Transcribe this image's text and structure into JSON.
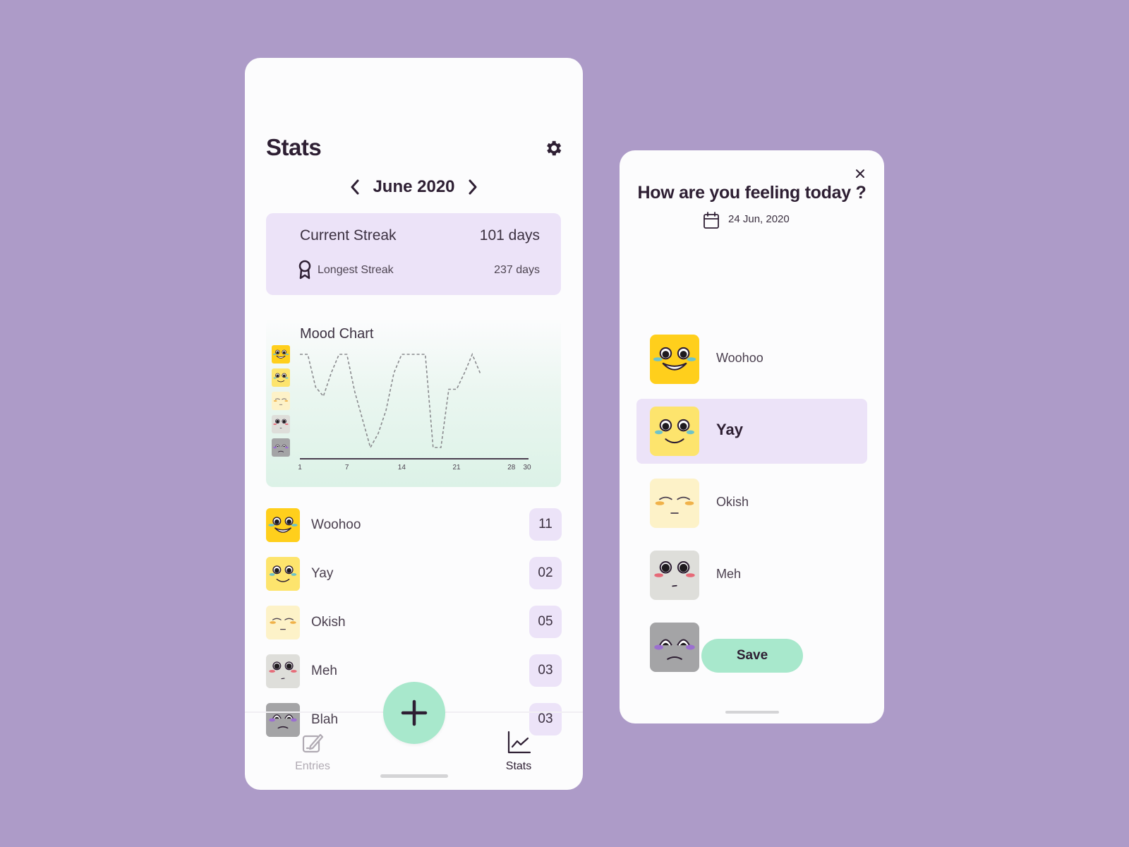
{
  "stats_screen": {
    "title": "Stats",
    "settings_icon": "gear-icon",
    "month": "June 2020",
    "streak": {
      "current_label": "Current Streak",
      "current_value": "101 days",
      "longest_label": "Longest Streak",
      "longest_value": "237 days",
      "longest_icon": "award-ribbon-icon"
    },
    "chart_title": "Mood Chart",
    "moods": [
      {
        "name": "Woohoo",
        "count": "11",
        "color": "#ffcf1c"
      },
      {
        "name": "Yay",
        "count": "02",
        "color": "#fde46d"
      },
      {
        "name": "Okish",
        "count": "05",
        "color": "#fdf2c8"
      },
      {
        "name": "Meh",
        "count": "03",
        "color": "#dededa"
      },
      {
        "name": "Blah",
        "count": "03",
        "color": "#a4a4a6"
      }
    ],
    "tabs": {
      "entries": "Entries",
      "stats": "Stats"
    },
    "fab_icon": "plus-icon"
  },
  "chart_data": {
    "type": "line",
    "title": "Mood Chart",
    "x_ticks": [
      1,
      7,
      14,
      21,
      28,
      30
    ],
    "y_levels": [
      "Blah",
      "Meh",
      "Okish",
      "Yay",
      "Woohoo"
    ],
    "ylim": [
      1,
      5
    ],
    "xlim": [
      1,
      30
    ],
    "line_style": "dashed",
    "series": [
      {
        "x": [
          1,
          2,
          3,
          4,
          5,
          6,
          7,
          8,
          9,
          10,
          11,
          12,
          13,
          14,
          15,
          16,
          17,
          18,
          19,
          20,
          21,
          22
        ],
        "values": [
          5,
          5,
          3.6,
          3.2,
          4.2,
          5,
          5,
          3.4,
          2.2,
          1,
          1.6,
          2.6,
          4.2,
          5,
          5,
          5,
          5,
          1,
          1,
          3.5,
          3.5,
          4.2
        ]
      }
    ],
    "extra_points": {
      "x": [
        23,
        24
      ],
      "values": [
        5,
        4.2
      ]
    }
  },
  "dialog": {
    "close_icon": "close-icon",
    "title": "How are you feeling today ?",
    "date": "24 Jun, 2020",
    "date_icon": "calendar-icon",
    "options": [
      {
        "name": "Woohoo",
        "selected": false
      },
      {
        "name": "Yay",
        "selected": true
      },
      {
        "name": "Okish",
        "selected": false
      },
      {
        "name": "Meh",
        "selected": false
      },
      {
        "name": "Blah",
        "selected": false
      }
    ],
    "save_label": "Save"
  },
  "colors": {
    "background": "#ad9bc8",
    "accent_lilac": "#ece3f8",
    "accent_mint": "#a8e8cc",
    "text_dark": "#2e1f33"
  }
}
